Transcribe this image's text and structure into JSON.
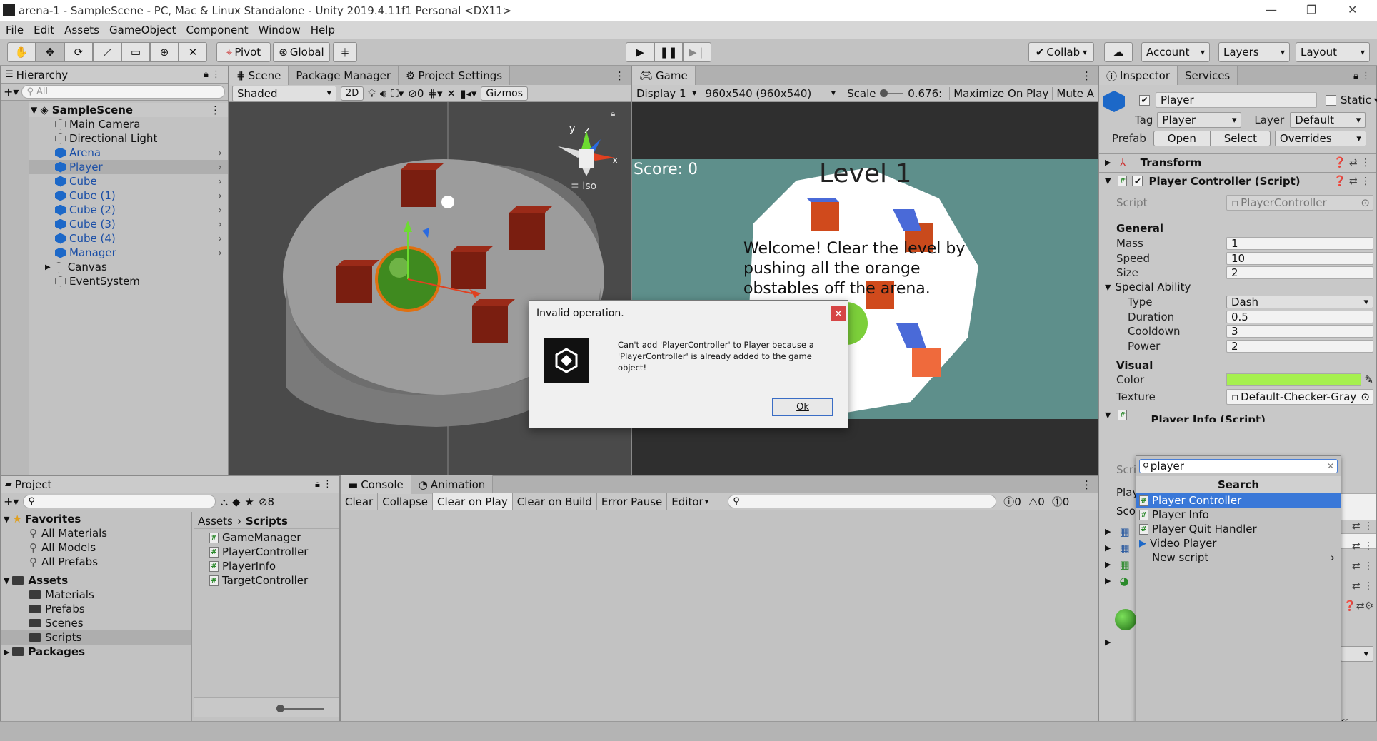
{
  "window": {
    "title": "arena-1 - SampleScene - PC, Mac & Linux Standalone - Unity 2019.4.11f1 Personal <DX11>"
  },
  "menu": [
    "File",
    "Edit",
    "Assets",
    "GameObject",
    "Component",
    "Window",
    "Help"
  ],
  "toolbar": {
    "pivot": "Pivot",
    "global": "Global",
    "collab": "Collab",
    "account": "Account",
    "layers": "Layers",
    "layout": "Layout"
  },
  "hierarchy": {
    "tab": "Hierarchy",
    "search_placeholder": "All",
    "scene": "SampleScene",
    "items": [
      {
        "label": "Main Camera",
        "blue": false,
        "arrow": false
      },
      {
        "label": "Directional Light",
        "blue": false,
        "arrow": false
      },
      {
        "label": "Arena",
        "blue": true,
        "arrow": true
      },
      {
        "label": "Player",
        "blue": true,
        "arrow": true,
        "selected": true
      },
      {
        "label": "Cube",
        "blue": true,
        "arrow": true
      },
      {
        "label": "Cube (1)",
        "blue": true,
        "arrow": true
      },
      {
        "label": "Cube (2)",
        "blue": true,
        "arrow": true
      },
      {
        "label": "Cube (3)",
        "blue": true,
        "arrow": true
      },
      {
        "label": "Cube (4)",
        "blue": true,
        "arrow": true
      },
      {
        "label": "Manager",
        "blue": true,
        "arrow": true
      },
      {
        "label": "Canvas",
        "blue": false,
        "arrow": false,
        "expander": true
      },
      {
        "label": "EventSystem",
        "blue": false,
        "arrow": false
      }
    ]
  },
  "scene": {
    "tabs": [
      "Scene",
      "Package Manager",
      "Project Settings"
    ],
    "shading": "Shaded",
    "mode2d": "2D",
    "hidden_count": "0",
    "gizmos": "Gizmos",
    "iso": "Iso",
    "axis_y": "y",
    "axis_z": "z",
    "axis_x": "x"
  },
  "game": {
    "tab": "Game",
    "display": "Display 1",
    "resolution": "960x540 (960x540)",
    "scale_label": "Scale",
    "scale_value": "0.676:",
    "maximize": "Maximize On Play",
    "mute": "Mute A",
    "score": "Score: 0",
    "level": "Level 1",
    "welcome": "Welcome! Clear the level by pushing all the orange obstables off the arena."
  },
  "dialog": {
    "title": "Invalid operation.",
    "message": "Can't add 'PlayerController' to Player because a 'PlayerController' is already added to the game object!",
    "ok": "Ok",
    "close": "×"
  },
  "inspector": {
    "tabs": [
      "Inspector",
      "Services"
    ],
    "name": "Player",
    "static": "Static",
    "tag_label": "Tag",
    "tag": "Player",
    "layer_label": "Layer",
    "layer": "Default",
    "prefab_label": "Prefab",
    "open": "Open",
    "select": "Select",
    "overrides": "Overrides",
    "transform": "Transform",
    "component": "Player Controller (Script)",
    "script_label": "Script",
    "script": "PlayerController",
    "general": "General",
    "fields": [
      {
        "label": "Mass",
        "value": "1"
      },
      {
        "label": "Speed",
        "value": "10"
      },
      {
        "label": "Size",
        "value": "2"
      }
    ],
    "special": "Special Ability",
    "special_fields": [
      {
        "label": "Type",
        "value": "Dash",
        "dropdown": true
      },
      {
        "label": "Duration",
        "value": "0.5"
      },
      {
        "label": "Cooldown",
        "value": "3"
      },
      {
        "label": "Power",
        "value": "2"
      }
    ],
    "visual": "Visual",
    "color_label": "Color",
    "color": "#a6f04f",
    "texture_label": "Texture",
    "texture": "Default-Checker-Gray",
    "next_component": "Player Info (Script)",
    "partial_labels": [
      "Scri",
      "Play",
      "Sco"
    ],
    "trailing": "ff"
  },
  "addcomp": {
    "search_value": "player",
    "search_header": "Search",
    "items": [
      {
        "label": "Player Controller",
        "icon": "#",
        "selected": true
      },
      {
        "label": "Player Info",
        "icon": "#"
      },
      {
        "label": "Player Quit Handler",
        "icon": "#"
      },
      {
        "label": "Video Player",
        "icon": "video"
      },
      {
        "label": "New script",
        "icon": "",
        "arrow": true
      }
    ]
  },
  "project": {
    "tab": "Project",
    "hidden_count": "8",
    "favorites": "Favorites",
    "fav_items": [
      "All Materials",
      "All Models",
      "All Prefabs"
    ],
    "assets": "Assets",
    "asset_folders": [
      "Materials",
      "Prefabs",
      "Scenes",
      "Scripts"
    ],
    "packages": "Packages",
    "breadcrumb": [
      "Assets",
      "Scripts"
    ],
    "files": [
      "GameManager",
      "PlayerController",
      "PlayerInfo",
      "TargetController"
    ]
  },
  "console": {
    "tabs": [
      "Console",
      "Animation"
    ],
    "buttons": [
      "Clear",
      "Collapse",
      "Clear on Play",
      "Clear on Build",
      "Error Pause",
      "Editor"
    ],
    "counts": [
      "0",
      "0",
      "0"
    ]
  }
}
